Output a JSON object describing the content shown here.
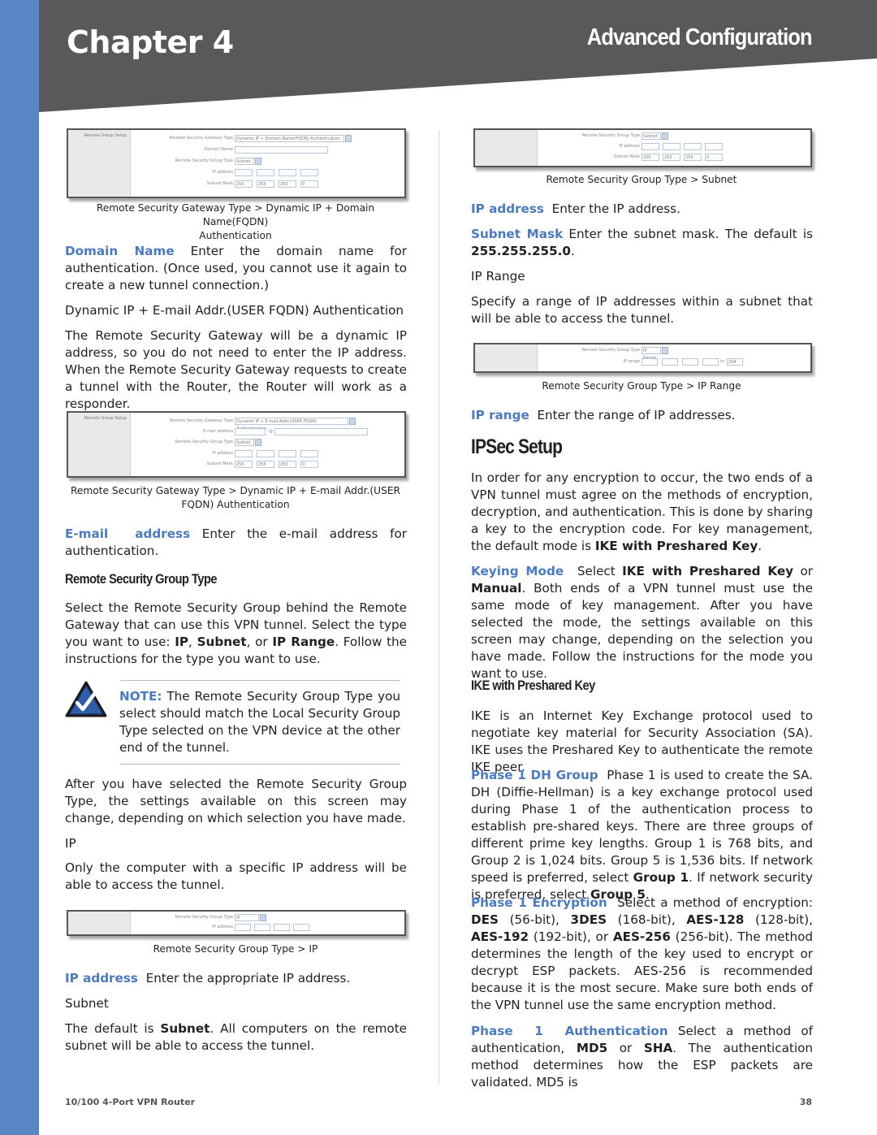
{
  "header": {
    "chapter": "Chapter 4",
    "section": "Advanced Configuration"
  },
  "colors": {
    "sidebar": "#5a86c5",
    "header_band": "#58595b",
    "term_blue": "#4a7bc0"
  },
  "left": {
    "shot1": {
      "panel_label": "Remote Group Setup",
      "gateway_type_label": "Remote Security Gateway Type",
      "gateway_type_value": "Dynamic IP + Domain Name(FQDN) Authentication",
      "domain_label": "Domain Name",
      "group_type_label": "Remote Security Group Type",
      "group_type_value": "Subnet",
      "ip_label": "IP address",
      "mask_label": "Subnet Mask",
      "mask_values": [
        "255",
        "255",
        "255",
        "0"
      ],
      "caption_line1": "Remote Security Gateway Type > Dynamic IP + Domain Name(FQDN)",
      "caption_line2": "Authentication"
    },
    "domain_name": {
      "term": "Domain Name",
      "text": " Enter the domain name for authentication. (Once used, you cannot use it again to create a new tunnel connection.)"
    },
    "dynamic_email_heading": "Dynamic IP + E-mail Addr.(USER FQDN) Authentication",
    "dynamic_email_text": "The Remote Security Gateway will be a dynamic IP address, so you do not need to enter the IP address. When the Remote Security Gateway requests to create a tunnel with the Router, the Router will work as a responder.",
    "shot2": {
      "panel_label": "Remote Group Setup",
      "gateway_type_label": "Remote Security Gateway Type",
      "gateway_type_value": "Dynamic IP + E-mail Addr.(USER FQDN) Authentication",
      "email_label": "E-mail address",
      "at": "@",
      "group_type_label": "Remote Security Group Type",
      "group_type_value": "Subnet",
      "ip_label": "IP address",
      "mask_label": "Subnet Mask",
      "mask_values": [
        "255",
        "255",
        "255",
        "0"
      ],
      "caption_line1": "Remote Security Gateway Type > Dynamic IP + E-mail Addr.(USER",
      "caption_line2": "FQDN) Authentication"
    },
    "email_address": {
      "term": "E-mail address",
      "text": " Enter the e-mail address for authentication."
    },
    "rsgt_heading": "Remote Security Group Type",
    "rsgt_text": {
      "a": "Select the Remote Security Group behind the Remote Gateway that can use this VPN tunnel. Select the type you want to use: ",
      "ip": "IP",
      "b": ", ",
      "subnet": "Subnet",
      "c": ", or ",
      "range": "IP Range",
      "d": ". Follow the instructions for the type you want to use."
    },
    "note": {
      "label": "NOTE:",
      "text": " The Remote Security Group Type you select should match the Local Security Group Type selected on the VPN device at the other end of the tunnel."
    },
    "after_text": "After you have selected the Remote Security Group Type, the settings available on this screen may change, depending on which selection you have made.",
    "ip_heading": "IP",
    "ip_text": "Only the computer with a specific IP address will be able to access the tunnel.",
    "shot3": {
      "group_type_label": "Remote Security Group Type",
      "group_type_value": "IP",
      "ip_label": "IP address",
      "caption": "Remote Security Group Type > IP"
    },
    "ip_address": {
      "term": "IP address",
      "text": "  Enter the appropriate IP address."
    },
    "subnet_heading": "Subnet",
    "subnet_text": {
      "a": "The default is ",
      "bold": "Subnet",
      "b": ". All computers on the remote subnet will be able to access the tunnel."
    }
  },
  "right": {
    "shot4": {
      "group_type_label": "Remote Security Group Type",
      "group_type_value": "Subnet",
      "ip_label": "IP address",
      "mask_label": "Subnet Mask",
      "mask_values": [
        "255",
        "255",
        "255",
        "0"
      ],
      "caption": "Remote Security Group Type > Subnet"
    },
    "ip_address": {
      "term": "IP address",
      "text": "  Enter the IP address."
    },
    "subnet_mask": {
      "term": "Subnet Mask",
      "text": " Enter the subnet mask. The default is ",
      "bold": "255.255.255.0",
      "end": "."
    },
    "ip_range_heading": "IP Range",
    "ip_range_text": "Specify a range of IP addresses within a subnet that will be able to access the tunnel.",
    "shot5": {
      "group_type_label": "Remote Security Group Type",
      "group_type_value": "IP Range",
      "range_label": "IP range",
      "to": "to",
      "to_value": "254",
      "caption": "Remote Security Group Type > IP Range"
    },
    "ip_range": {
      "term": "IP range",
      "text": "  Enter the range of IP addresses."
    },
    "ipsec_heading": "IPSec Setup",
    "ipsec_text": {
      "a": "In order for any encryption to occur, the two ends of a VPN tunnel must agree on the methods of encryption, decryption, and authentication. This is done by sharing a key to the encryption code. For key management, the default mode is ",
      "bold": "IKE with Preshared Key",
      "b": "."
    },
    "keying_mode": {
      "term": "Keying Mode",
      "a": "  Select ",
      "b1": "IKE with Preshared Key",
      "b": " or ",
      "b2": "Manual",
      "c": ". Both ends of a VPN tunnel must use the same mode of key management. After you have selected the mode, the settings available on this screen may change, depending on the selection you have made. Follow the instructions for the mode you want to use."
    },
    "ike_heading": "IKE with Preshared Key",
    "ike_text": "IKE is an Internet Key Exchange protocol used to negotiate key material for Security Association (SA). IKE uses the Preshared Key to authenticate the remote IKE peer.",
    "phase1_dh": {
      "term": "Phase 1 DH Group",
      "a": "  Phase 1 is used to create the SA. DH (Diffie-Hellman) is a key exchange protocol used during Phase 1 of the authentication process to establish pre-shared keys. There are three groups of different prime key lengths. Group 1 is 768 bits, and Group 2 is 1,024 bits. Group 5 is 1,536 bits. If network speed is preferred, select ",
      "g1": "Group 1",
      "b": ". If network security is preferred, select ",
      "g5": "Group 5",
      "c": "."
    },
    "phase1_enc": {
      "term": "Phase 1 Encryption",
      "a": "  Select a method of encryption: ",
      "des": "DES",
      "b": " (56-bit), ",
      "tdes": "3DES",
      "c": " (168-bit), ",
      "aes128": "AES-128",
      "d": " (128-bit), ",
      "aes192": "AES-192",
      "e": " (192-bit), or ",
      "aes256": "AES-256",
      "f": " (256-bit). The method determines the length of the key used to encrypt or decrypt ESP packets. AES-256 is recommended because it is the most secure. Make sure both ends of the VPN tunnel use the same encryption method."
    },
    "phase1_auth": {
      "term": "Phase 1 Authentication",
      "a": " Select a method of authentication, ",
      "md5": "MD5",
      "b": " or ",
      "sha": "SHA",
      "c": ". The authentication method determines how the ESP packets are validated. MD5 is"
    }
  },
  "footer": {
    "product": "10/100 4-Port VPN Router",
    "page": "38"
  }
}
